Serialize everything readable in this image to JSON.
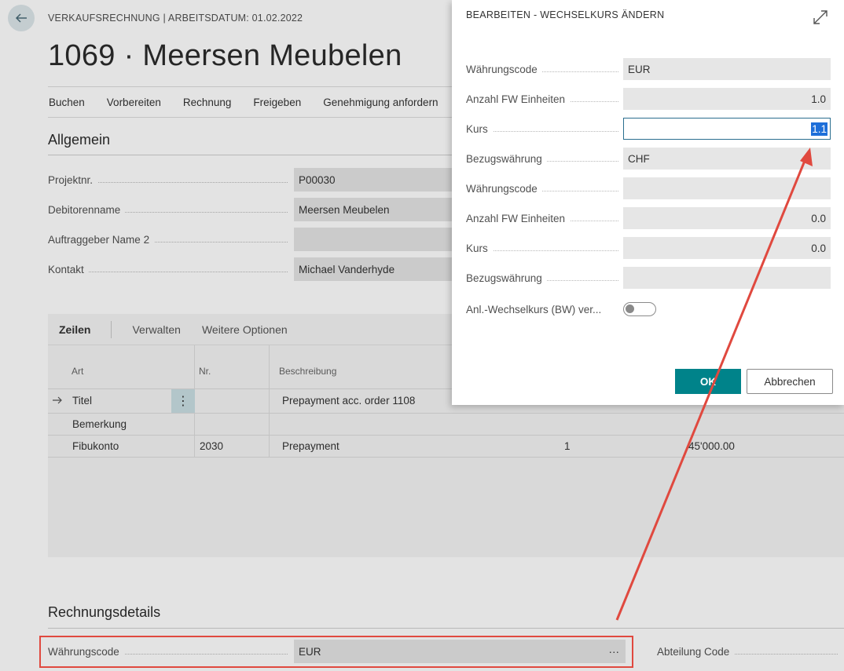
{
  "page": {
    "breadcrumb": "VERKAUFSRECHNUNG | ARBEITSDATUM: 01.02.2022",
    "title": "1069 · Meersen Meubelen",
    "actions": [
      "Buchen",
      "Vorbereiten",
      "Rechnung",
      "Freigeben",
      "Genehmigung anfordern"
    ]
  },
  "general": {
    "section_title": "Allgemein",
    "fields": [
      {
        "label": "Projektnr.",
        "value": "P00030"
      },
      {
        "label": "Debitorenname",
        "value": "Meersen Meubelen"
      },
      {
        "label": "Auftraggeber Name 2",
        "value": ""
      },
      {
        "label": "Kontakt",
        "value": "Michael Vanderhyde"
      }
    ]
  },
  "lines": {
    "tabs": [
      "Zeilen",
      "Verwalten",
      "Weitere Optionen"
    ],
    "columns": [
      "Art",
      "Nr.",
      "Beschreibung"
    ],
    "rows": [
      {
        "art": "Titel",
        "nr": "",
        "beschreibung": "Prepayment acc. order 1108",
        "qty": "",
        "amount": ""
      },
      {
        "art": "Bemerkung",
        "nr": "",
        "beschreibung": "",
        "qty": "",
        "amount": ""
      },
      {
        "art": "Fibukonto",
        "nr": "2030",
        "beschreibung": "Prepayment",
        "qty": "1",
        "amount": "45'000.00"
      }
    ]
  },
  "invoice_details": {
    "section_title": "Rechnungsdetails",
    "currency_label": "Währungscode",
    "currency_value": "EUR",
    "dept_label": "Abteilung Code",
    "more_glyph": "···"
  },
  "dialog": {
    "title": "BEARBEITEN - WECHSELKURS ÄNDERN",
    "fields": [
      {
        "label": "Währungscode",
        "value": "EUR",
        "numeric": false
      },
      {
        "label": "Anzahl FW Einheiten",
        "value": "1.0",
        "numeric": true
      },
      {
        "label": "Kurs",
        "value": "1.1",
        "numeric": true
      },
      {
        "label": "Bezugswährung",
        "value": "CHF",
        "numeric": false
      },
      {
        "label": "Währungscode",
        "value": "",
        "numeric": false
      },
      {
        "label": "Anzahl FW Einheiten",
        "value": "0.0",
        "numeric": true
      },
      {
        "label": "Kurs",
        "value": "0.0",
        "numeric": true
      },
      {
        "label": "Bezugswährung",
        "value": "",
        "numeric": false
      }
    ],
    "toggle_label": "Anl.-Wechselkurs (BW) ver...",
    "toggle_on": false,
    "ok_label": "OK",
    "cancel_label": "Abbrechen"
  },
  "colors": {
    "accent": "#00838a",
    "annotation": "#e0493f",
    "selection": "#1e6fd9"
  }
}
